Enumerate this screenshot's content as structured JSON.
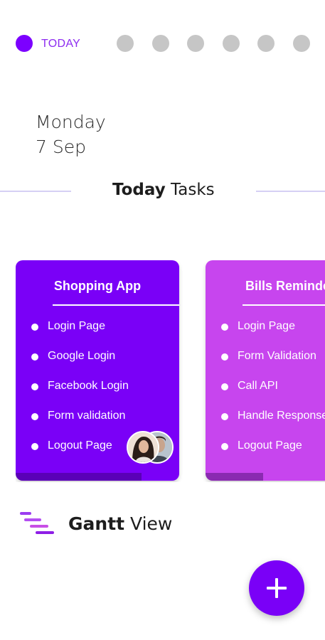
{
  "day_strip": {
    "active_label": "TODAY",
    "dot_count": 6
  },
  "date": {
    "weekday": "Monday",
    "day_month": "7 Sep"
  },
  "section": {
    "title_bold": "Today",
    "title_rest": "Tasks"
  },
  "cards": [
    {
      "title": "Shopping App",
      "color": "#7a00f7",
      "progress": 0.77,
      "tasks": [
        "Login Page",
        "Google Login",
        "Facebook Login",
        "Form validation",
        "Logout Page"
      ]
    },
    {
      "title": "Bills Reminder",
      "color": "#c745ee",
      "progress": 0.35,
      "tasks": [
        "Login Page",
        "Form Validation",
        "Call API",
        "Handle Response",
        "Logout Page"
      ]
    }
  ],
  "gantt": {
    "label_bold": "Gantt",
    "label_rest": "View",
    "icon": "gantt-icon"
  },
  "fab": {
    "icon": "plus-icon",
    "color": "#7a00f7"
  },
  "colors": {
    "accent": "#7a00f7",
    "accent_pink": "#c745ee",
    "inactive_dot": "#c6c6c6"
  }
}
